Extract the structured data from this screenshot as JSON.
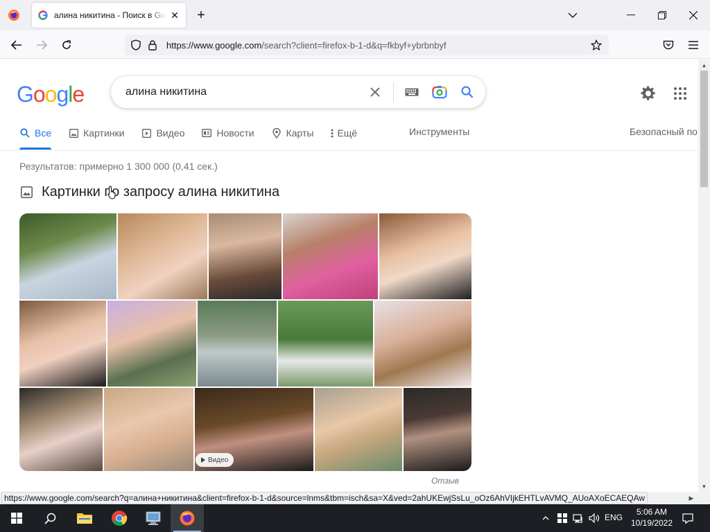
{
  "browser": {
    "tab_title": "алина никитина - Поиск в Google",
    "url_host": "https://www.google.com",
    "url_path": "/search?client=firefox-b-1-d&q=fkbyf+ybrbnbyf",
    "status_url": "https://www.google.com/search?q=алина+никитина&client=firefox-b-1-d&source=lnms&tbm=isch&sa=X&ved=2ahUKEwjSsLu_oOz6AhVIjkEHTLvAVMQ_AUoAXoECAEQAw"
  },
  "google": {
    "logo": [
      "G",
      "o",
      "o",
      "g",
      "l",
      "e"
    ],
    "query": "алина никитина",
    "tabs": [
      {
        "label": "Все",
        "icon": "search-icon"
      },
      {
        "label": "Картинки",
        "icon": "image-icon"
      },
      {
        "label": "Видео",
        "icon": "play-icon"
      },
      {
        "label": "Новости",
        "icon": "news-icon"
      },
      {
        "label": "Карты",
        "icon": "map-pin-icon"
      },
      {
        "label": "Ещё",
        "icon": "more-vert-icon"
      }
    ],
    "tools": "Инструменты",
    "safe_search": "Безопасный по",
    "results_stats": "Результатов: примерно 1 300 000 (0,41 сек.)",
    "images_heading": "Картинки по запросу алина никитина",
    "video_badge": "Видео",
    "feedback": "Отзыв"
  },
  "taskbar": {
    "lang": "ENG",
    "time": "5:06 AM",
    "date": "10/19/2022"
  },
  "colors": {
    "google_blue": "#1a73e8",
    "taskbar": "#1c1f24"
  }
}
